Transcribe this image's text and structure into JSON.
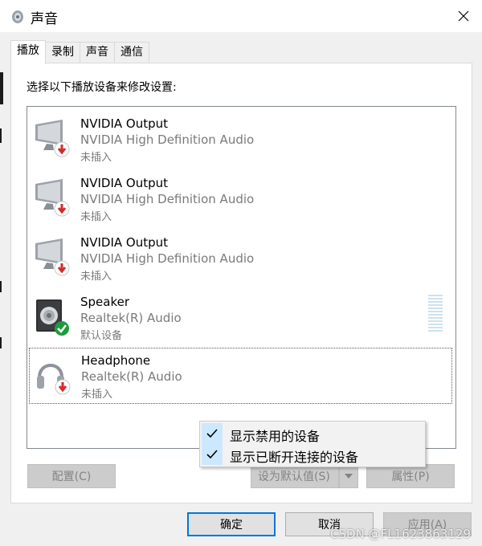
{
  "window": {
    "title": "声音",
    "close_symbol": "✕"
  },
  "tabs": [
    {
      "label": "播放",
      "active": true
    },
    {
      "label": "录制",
      "active": false
    },
    {
      "label": "声音",
      "active": false
    },
    {
      "label": "通信",
      "active": false
    }
  ],
  "instruction": "选择以下播放设备来修改设置:",
  "devices": [
    {
      "name": "NVIDIA Output",
      "driver": "NVIDIA High Definition Audio",
      "status": "未插入",
      "icon": "monitor-icon",
      "badge": "unplugged-badge-icon"
    },
    {
      "name": "NVIDIA Output",
      "driver": "NVIDIA High Definition Audio",
      "status": "未插入",
      "icon": "monitor-icon",
      "badge": "unplugged-badge-icon"
    },
    {
      "name": "NVIDIA Output",
      "driver": "NVIDIA High Definition Audio",
      "status": "未插入",
      "icon": "monitor-icon",
      "badge": "unplugged-badge-icon"
    },
    {
      "name": "Speaker",
      "driver": "Realtek(R) Audio",
      "status": "默认设备",
      "icon": "speaker-icon",
      "badge": "default-check-badge-icon"
    },
    {
      "name": "Headphone",
      "driver": "Realtek(R) Audio",
      "status": "未插入",
      "icon": "headphone-icon",
      "badge": "unplugged-badge-icon"
    }
  ],
  "context_menu": [
    {
      "label": "显示禁用的设备",
      "checked": true
    },
    {
      "label": "显示已断开连接的设备",
      "checked": true
    }
  ],
  "buttons": {
    "configure": "配置(C)",
    "set_default": "设为默认值(S)",
    "properties": "属性(P)",
    "ok": "确定",
    "cancel": "取消",
    "apply": "应用(A)"
  },
  "watermark": "CSDN @FL1623863129",
  "colors": {
    "badge_red": "#d42a2a",
    "badge_green": "#1e9b3c",
    "accent": "#0078d7",
    "menu_highlight": "#cce8ff"
  }
}
